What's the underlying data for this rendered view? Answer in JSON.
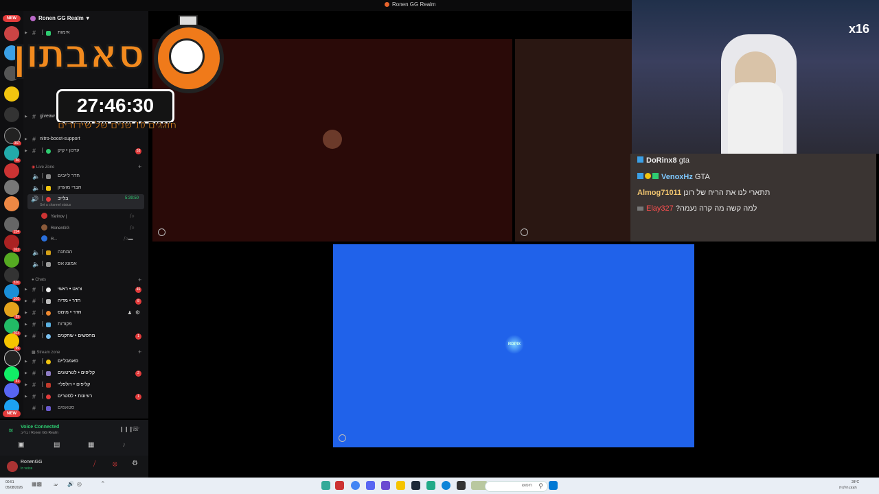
{
  "window": {
    "title": "Ronen GG Realm"
  },
  "server": {
    "name": "Ronen GG Realm"
  },
  "guild_badges": [
    "367",
    "36",
    "154",
    "162",
    "520",
    "106",
    "99",
    "203",
    "99",
    "41",
    "NEW",
    "NEW"
  ],
  "channels_top": [
    {
      "label": "אימות",
      "badge": ""
    },
    {
      "label": "giveaw",
      "badge": ""
    },
    {
      "label": "nitro-boost-support",
      "badge": ""
    },
    {
      "label": "עדכון • קיק",
      "badge": "53"
    }
  ],
  "live_zone": {
    "category": "Live Zone",
    "voice": [
      {
        "label": "חדר לייבים"
      },
      {
        "label": "חברי מועדון"
      }
    ],
    "active": {
      "label": "בלייב",
      "time": "5:39:50",
      "status": "Set a channel status"
    },
    "users": [
      "Yarinov |",
      "RonenGG",
      "R..."
    ],
    "more_voice": [
      {
        "label": "המתנה"
      },
      {
        "label": "אמונג אס"
      }
    ]
  },
  "chats": {
    "category": "Chats",
    "items": [
      {
        "label": "צ'אט • ראשי",
        "badge": "46"
      },
      {
        "label": "חדר • מדיה",
        "badge": "8"
      },
      {
        "label": "חדר • מימס",
        "badge": ""
      },
      {
        "label": "פקודות",
        "badge": ""
      },
      {
        "label": "מחפשים • שחקנים",
        "badge": "1"
      }
    ]
  },
  "stream_zone": {
    "category": "Stream zone",
    "items": [
      {
        "label": "סאמבליים",
        "badge": ""
      },
      {
        "label": "קליפים • לטרטונים",
        "badge": "2"
      },
      {
        "label": "קליפים • רולפליי",
        "badge": ""
      },
      {
        "label": "רעיונות • לסטרים",
        "badge": "1"
      },
      {
        "label": "סטאפים",
        "badge": ""
      }
    ]
  },
  "voice_status": {
    "title": "Voice Connected",
    "sub": "בלייב / Ronen GG Realm"
  },
  "user": {
    "name": "RonenGG",
    "status": "In voice"
  },
  "overlay": {
    "title": "סאבתון",
    "timer": "27:46:30",
    "subtitle": "חוגגים 10 שנים של שידורים"
  },
  "webcam": {
    "multiplier": "x16"
  },
  "chat": [
    {
      "name": "DoRinx8",
      "msg": "gta",
      "color": "#ffffff"
    },
    {
      "name": "VenoxHz",
      "msg": "GTA",
      "color": "#7ec8ff"
    },
    {
      "name": "Almog71011",
      "msg": "תתארי לנו את הריח של רונן",
      "color": "#f3c770"
    },
    {
      "name": "Elay327",
      "msg": "?למה קשה מה קרה נעמה",
      "color": "#ff4f4f"
    }
  ],
  "tile3_label": "RDPIX",
  "taskbar": {
    "time": "00:51",
    "date": "05/08/2026",
    "search_placeholder": "חיפוש",
    "weather_temp": "28°C",
    "weather_text": "מעונן חלקית",
    "lang": "עב"
  }
}
